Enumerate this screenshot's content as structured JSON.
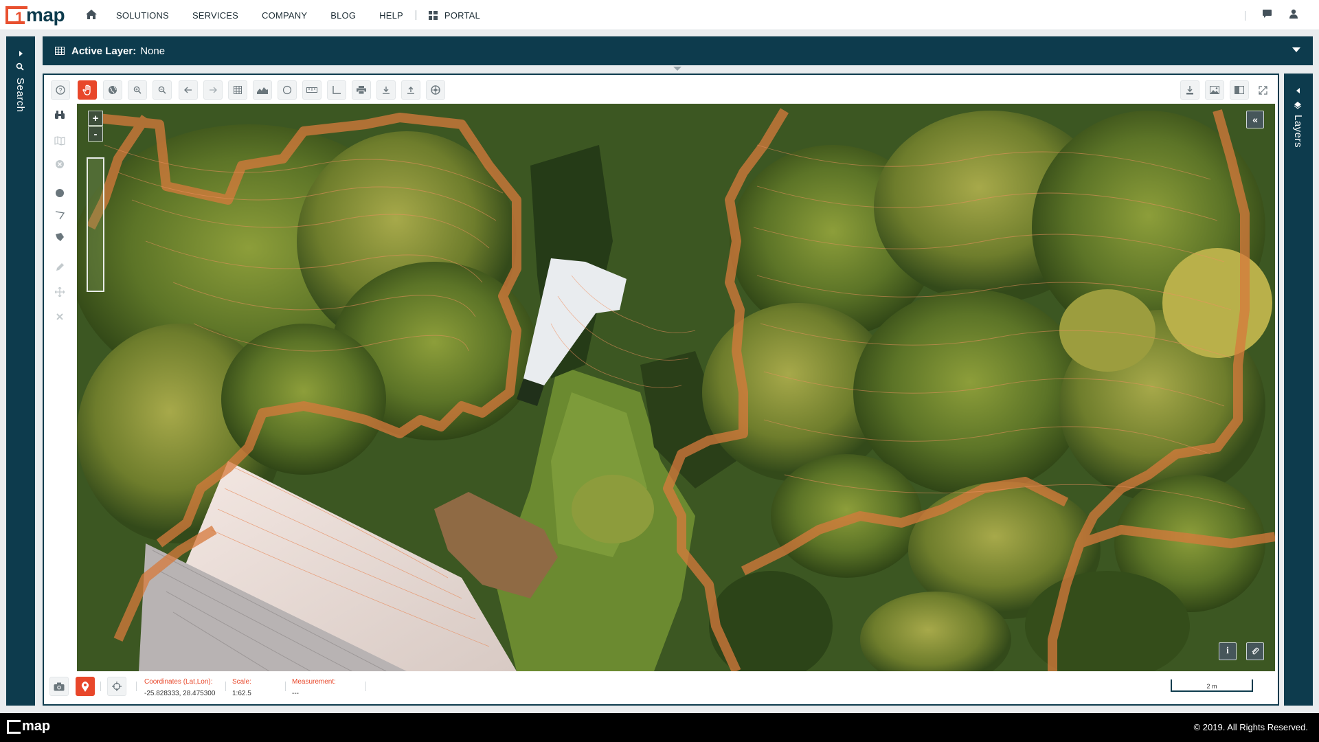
{
  "brand": {
    "logo_text": "map",
    "logo_digit": "1"
  },
  "nav": {
    "items": [
      "SOLUTIONS",
      "SERVICES",
      "COMPANY",
      "BLOG",
      "HELP"
    ],
    "portal_label": "PORTAL"
  },
  "sidebar_left": {
    "label": "Search"
  },
  "sidebar_right": {
    "label": "Layers"
  },
  "active_layer": {
    "label": "Active Layer:",
    "value": "None"
  },
  "toolbar": {
    "tools": [
      "help-icon",
      "pan-hand-icon",
      "globe-icon",
      "zoom-in-icon",
      "zoom-out-icon",
      "back-arrow-icon",
      "forward-arrow-icon",
      "table-icon",
      "elevation-profile-icon",
      "circle-icon",
      "ruler-icon",
      "angle-icon",
      "print-icon",
      "download-icon",
      "upload-icon",
      "settings-wheel-icon"
    ],
    "right_tools": [
      "download-file-icon",
      "image-export-icon",
      "split-view-icon",
      "fullscreen-icon"
    ]
  },
  "map": {
    "zoom_in": "+",
    "zoom_out": "-",
    "collapse": "«",
    "info": "i"
  },
  "status": {
    "coordinates_label": "Coordinates (Lat,Lon):",
    "coordinates_value": "-25.828333, 28.475300",
    "scale_label": "Scale:",
    "scale_value": "1:62.5",
    "measurement_label": "Measurement:",
    "measurement_value": "---",
    "scalebar_label": "2 m"
  },
  "footer": {
    "copyright": "© 2019. All Rights Reserved."
  },
  "colors": {
    "primary": "#0d3b4d",
    "accent": "#e8472a",
    "contour": "#e87a3a"
  }
}
